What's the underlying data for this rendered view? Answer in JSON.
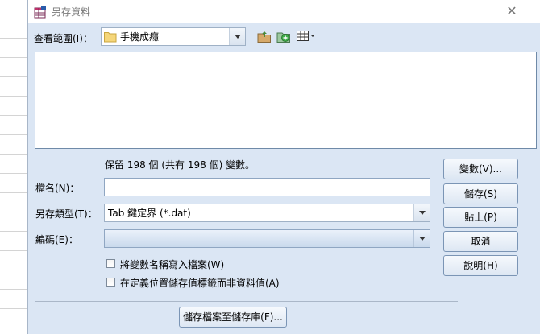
{
  "window": {
    "title": "另存資料"
  },
  "lookin": {
    "label": "查看範圍(I)：",
    "folder": "手機成癮"
  },
  "info": {
    "retained_text": "保留 198 個 (共有 198 個) 變數。"
  },
  "fields": {
    "filename_label": "檔名(N)：",
    "filename_value": "",
    "savetype_label": "另存類型(T)：",
    "savetype_value": "Tab 鍵定界 (*.dat)",
    "encoding_label": "編碼(E)：",
    "encoding_value": ""
  },
  "checkboxes": [
    {
      "label": "將變數名稱寫入檔案(W)",
      "checked": false
    },
    {
      "label": "在定義位置儲存值標籤而非資料值(A)",
      "checked": false
    }
  ],
  "buttons": {
    "variables": "變數(V)...",
    "save": "儲存(S)",
    "paste": "貼上(P)",
    "cancel": "取消",
    "help": "說明(H)",
    "repository": "儲存檔案至儲存庫(F)..."
  },
  "icons": {
    "title": "spss-data-icon",
    "folder": "folder-icon",
    "up_folder": "up-folder-icon",
    "new_folder": "new-folder-icon",
    "view_menu": "view-menu-icon",
    "close": "close-icon"
  },
  "colors": {
    "dialog_bg": "#dbe6f4",
    "button_border": "#7b95b5",
    "title_text": "#7a7a7a"
  }
}
